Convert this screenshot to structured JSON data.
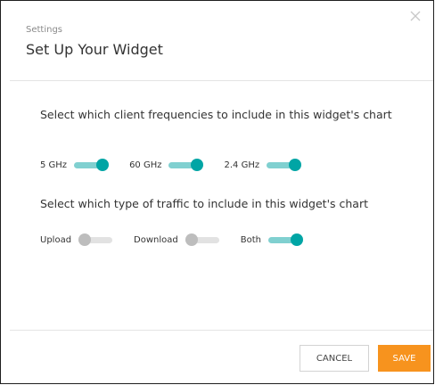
{
  "header": {
    "subtitle": "Settings",
    "title": "Set Up Your Widget"
  },
  "frequencies": {
    "question": "Select which client frequencies to include in this widget's chart",
    "toggles": [
      {
        "label": "5 GHz",
        "on": true
      },
      {
        "label": "60 GHz",
        "on": true
      },
      {
        "label": "2.4 GHz",
        "on": true
      }
    ]
  },
  "traffic": {
    "question": "Select which type of traffic to include in this widget's chart",
    "toggles": [
      {
        "label": "Upload",
        "on": false
      },
      {
        "label": "Download",
        "on": false
      },
      {
        "label": "Both",
        "on": true
      }
    ]
  },
  "footer": {
    "cancel_label": "CANCEL",
    "save_label": "SAVE"
  },
  "colors": {
    "accent": "#00a5a5",
    "save": "#f7931e"
  }
}
